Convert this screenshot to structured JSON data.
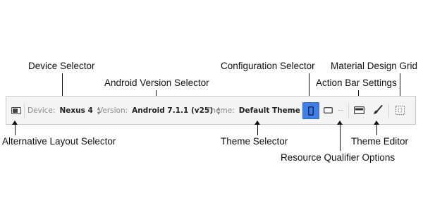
{
  "annotations": {
    "device_selector": "Device Selector",
    "android_version_selector": "Android Version Selector",
    "configuration_selector": "Configuration Selector",
    "material_design_grid": "Material Design Grid",
    "action_bar_settings": "Action Bar Settings",
    "alternative_layout_selector": "Alternative Layout Selector",
    "theme_selector": "Theme Selector",
    "theme_editor": "Theme Editor",
    "resource_qualifier_options": "Resource Qualifier Options"
  },
  "toolbar": {
    "device_label": "Device:",
    "device_value": "Nexus 4",
    "version_label": "Version:",
    "version_value": "Android 7.1.1 (v25)",
    "theme_label": "Theme:",
    "theme_value": "Default Theme",
    "more_glyph": "···",
    "selected_color": "#3d7fe6"
  },
  "icons": {
    "alternative_layout": "layout-icon",
    "portrait": "portrait-phone-icon",
    "landscape": "landscape-phone-icon",
    "action_bar": "action-bar-icon",
    "theme_editor": "paintbrush-icon",
    "grid": "grid-icon"
  }
}
